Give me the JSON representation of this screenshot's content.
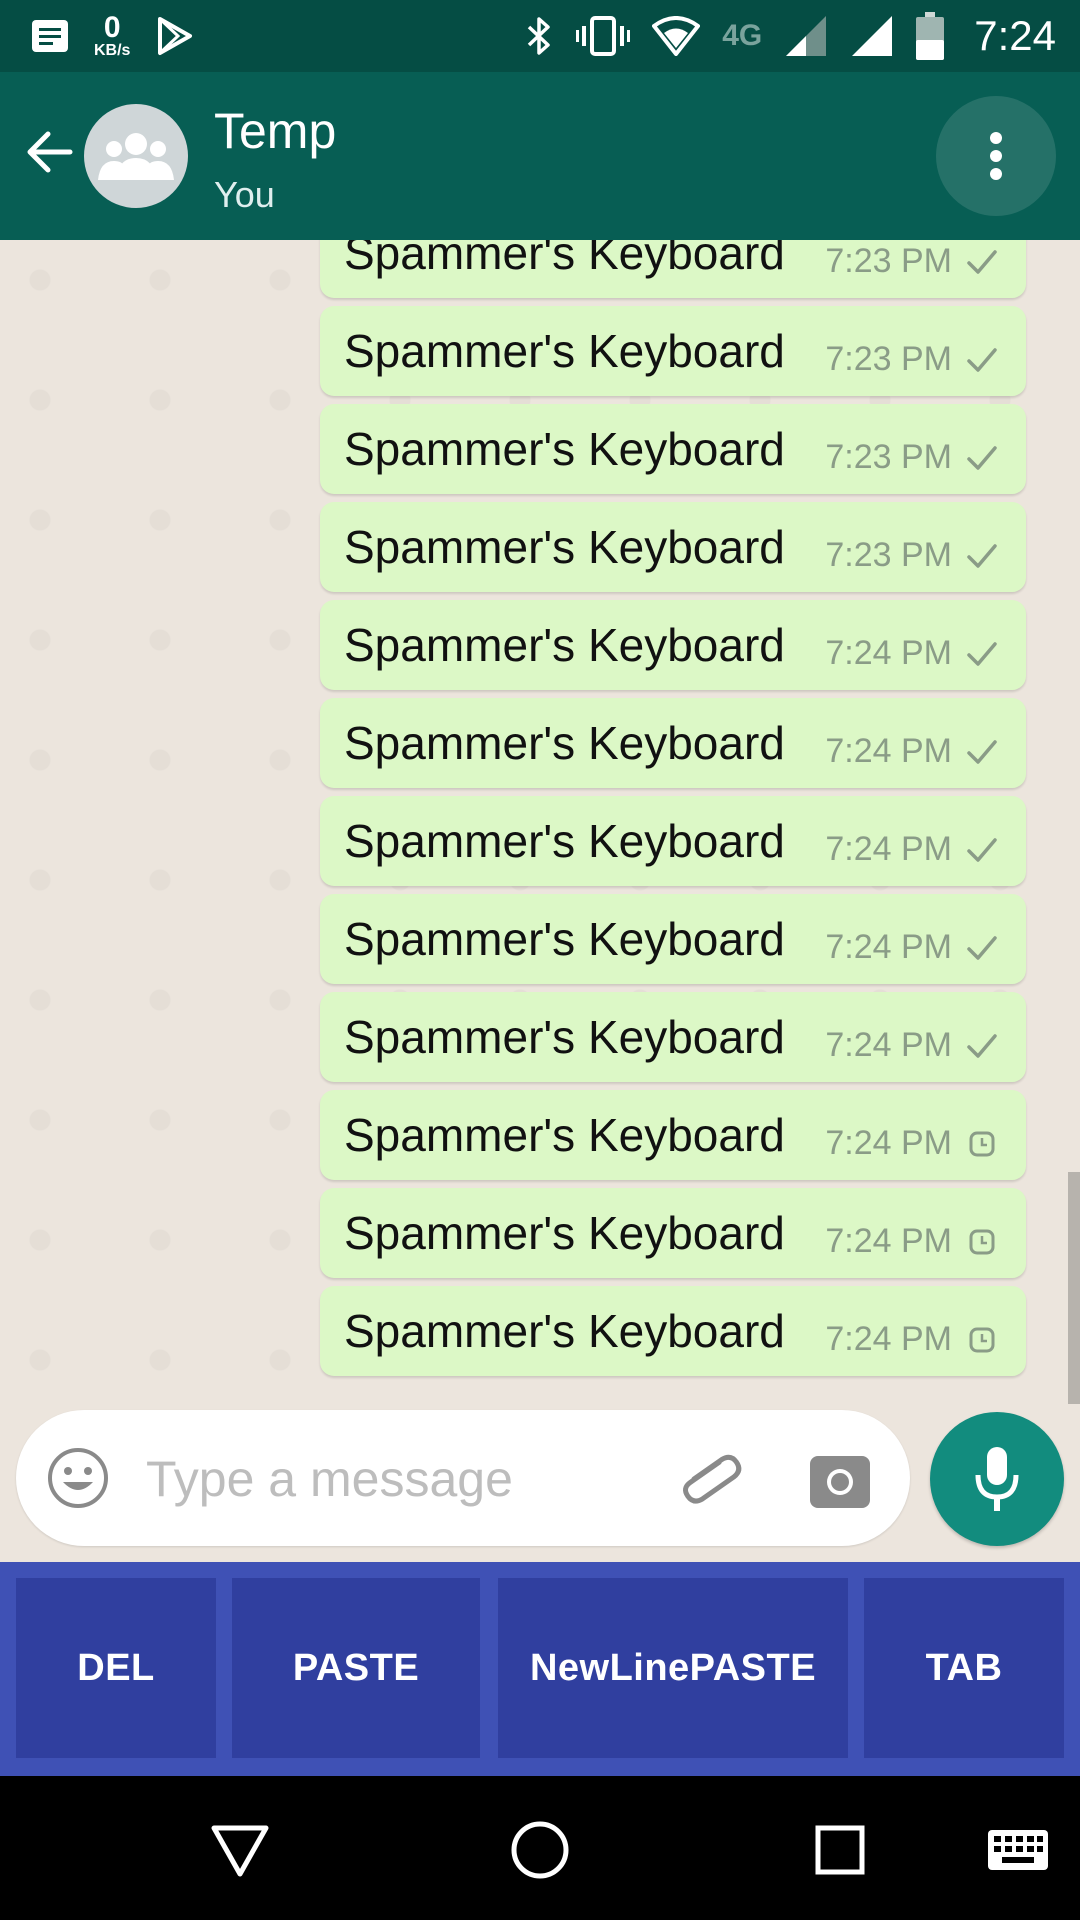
{
  "status_bar": {
    "time": "7:24",
    "net_speed_value": "0",
    "net_speed_unit": "KB/s",
    "network_type": "4G",
    "icons": [
      "notification-icon",
      "net-speed-icon",
      "play-store-icon",
      "bluetooth-icon",
      "vibrate-icon",
      "wifi-icon",
      "signal-icon",
      "signal-full-icon",
      "battery-icon"
    ]
  },
  "header": {
    "title": "Temp",
    "subtitle": "You",
    "icons": [
      "back-arrow-icon",
      "group-avatar-icon",
      "more-vert-icon"
    ]
  },
  "messages": [
    {
      "text": "Spammer's Keyboard",
      "time": "7:23 PM",
      "status": "sent"
    },
    {
      "text": "Spammer's Keyboard",
      "time": "7:23 PM",
      "status": "sent"
    },
    {
      "text": "Spammer's Keyboard",
      "time": "7:23 PM",
      "status": "sent"
    },
    {
      "text": "Spammer's Keyboard",
      "time": "7:23 PM",
      "status": "sent"
    },
    {
      "text": "Spammer's Keyboard",
      "time": "7:24 PM",
      "status": "sent"
    },
    {
      "text": "Spammer's Keyboard",
      "time": "7:24 PM",
      "status": "sent"
    },
    {
      "text": "Spammer's Keyboard",
      "time": "7:24 PM",
      "status": "sent"
    },
    {
      "text": "Spammer's Keyboard",
      "time": "7:24 PM",
      "status": "sent"
    },
    {
      "text": "Spammer's Keyboard",
      "time": "7:24 PM",
      "status": "sent"
    },
    {
      "text": "Spammer's Keyboard",
      "time": "7:24 PM",
      "status": "pending"
    },
    {
      "text": "Spammer's Keyboard",
      "time": "7:24 PM",
      "status": "pending"
    },
    {
      "text": "Spammer's Keyboard",
      "time": "7:24 PM",
      "status": "pending"
    }
  ],
  "composer": {
    "placeholder": "Type a message",
    "value": "",
    "icons": [
      "emoji-icon",
      "attach-icon",
      "camera-icon",
      "mic-icon"
    ]
  },
  "keyboard": {
    "keys": [
      "DEL",
      "PASTE",
      "NewLinePASTE",
      "TAB"
    ]
  },
  "nav_bar": {
    "icons": [
      "back-triangle-icon",
      "home-circle-icon",
      "recents-square-icon",
      "keyboard-switch-icon"
    ]
  },
  "colors": {
    "status_bar": "#054d44",
    "app_bar": "#075e54",
    "bubble": "#dcf8c6",
    "mic_button": "#128c7e",
    "keyboard_bg": "#3f51b5",
    "key_bg": "#303f9f"
  }
}
